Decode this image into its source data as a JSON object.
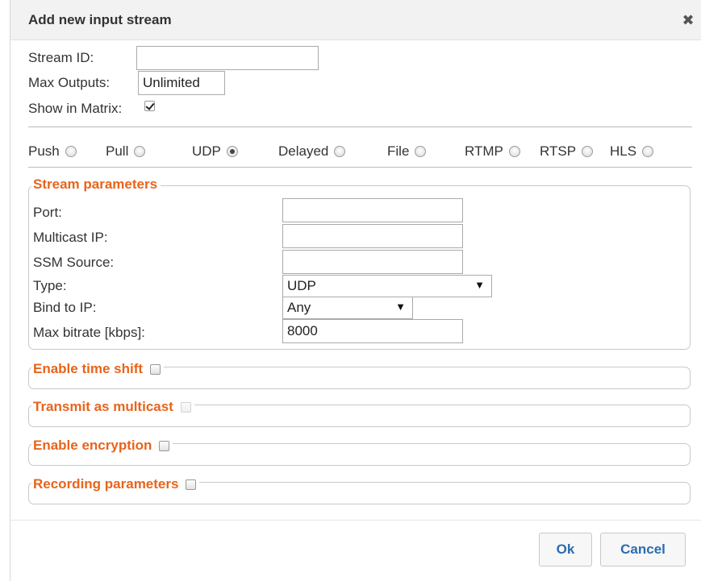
{
  "dialog": {
    "title": "Add new input stream",
    "close_glyph": "✖"
  },
  "general": {
    "stream_id_label": "Stream ID:",
    "stream_id_value": "",
    "max_outputs_label": "Max Outputs:",
    "max_outputs_value": "Unlimited",
    "show_in_matrix_label": "Show in Matrix:",
    "show_in_matrix_checked": true
  },
  "protocols": [
    {
      "label": "Push",
      "selected": false
    },
    {
      "label": "Pull",
      "selected": false
    },
    {
      "label": "UDP",
      "selected": true
    },
    {
      "label": "Delayed",
      "selected": false
    },
    {
      "label": "File",
      "selected": false
    },
    {
      "label": "RTMP",
      "selected": false
    },
    {
      "label": "RTSP",
      "selected": false
    },
    {
      "label": "HLS",
      "selected": false
    }
  ],
  "stream_params": {
    "legend": "Stream parameters",
    "port_label": "Port:",
    "port_value": "",
    "multicast_ip_label": "Multicast IP:",
    "multicast_ip_value": "",
    "ssm_source_label": "SSM Source:",
    "ssm_source_value": "",
    "type_label": "Type:",
    "type_value": "UDP",
    "bind_ip_label": "Bind to IP:",
    "bind_ip_value": "Any",
    "max_bitrate_label": "Max bitrate [kbps]:",
    "max_bitrate_value": "8000"
  },
  "sections": {
    "time_shift": "Enable time shift",
    "transmit_multicast": "Transmit as multicast",
    "encryption": "Enable encryption",
    "recording": "Recording parameters"
  },
  "footer": {
    "ok_label": "Ok",
    "cancel_label": "Cancel"
  },
  "colors": {
    "accent_orange": "#e8641b",
    "button_text_blue": "#2b6cb0",
    "titlebar_bg": "#f2f2f2"
  }
}
